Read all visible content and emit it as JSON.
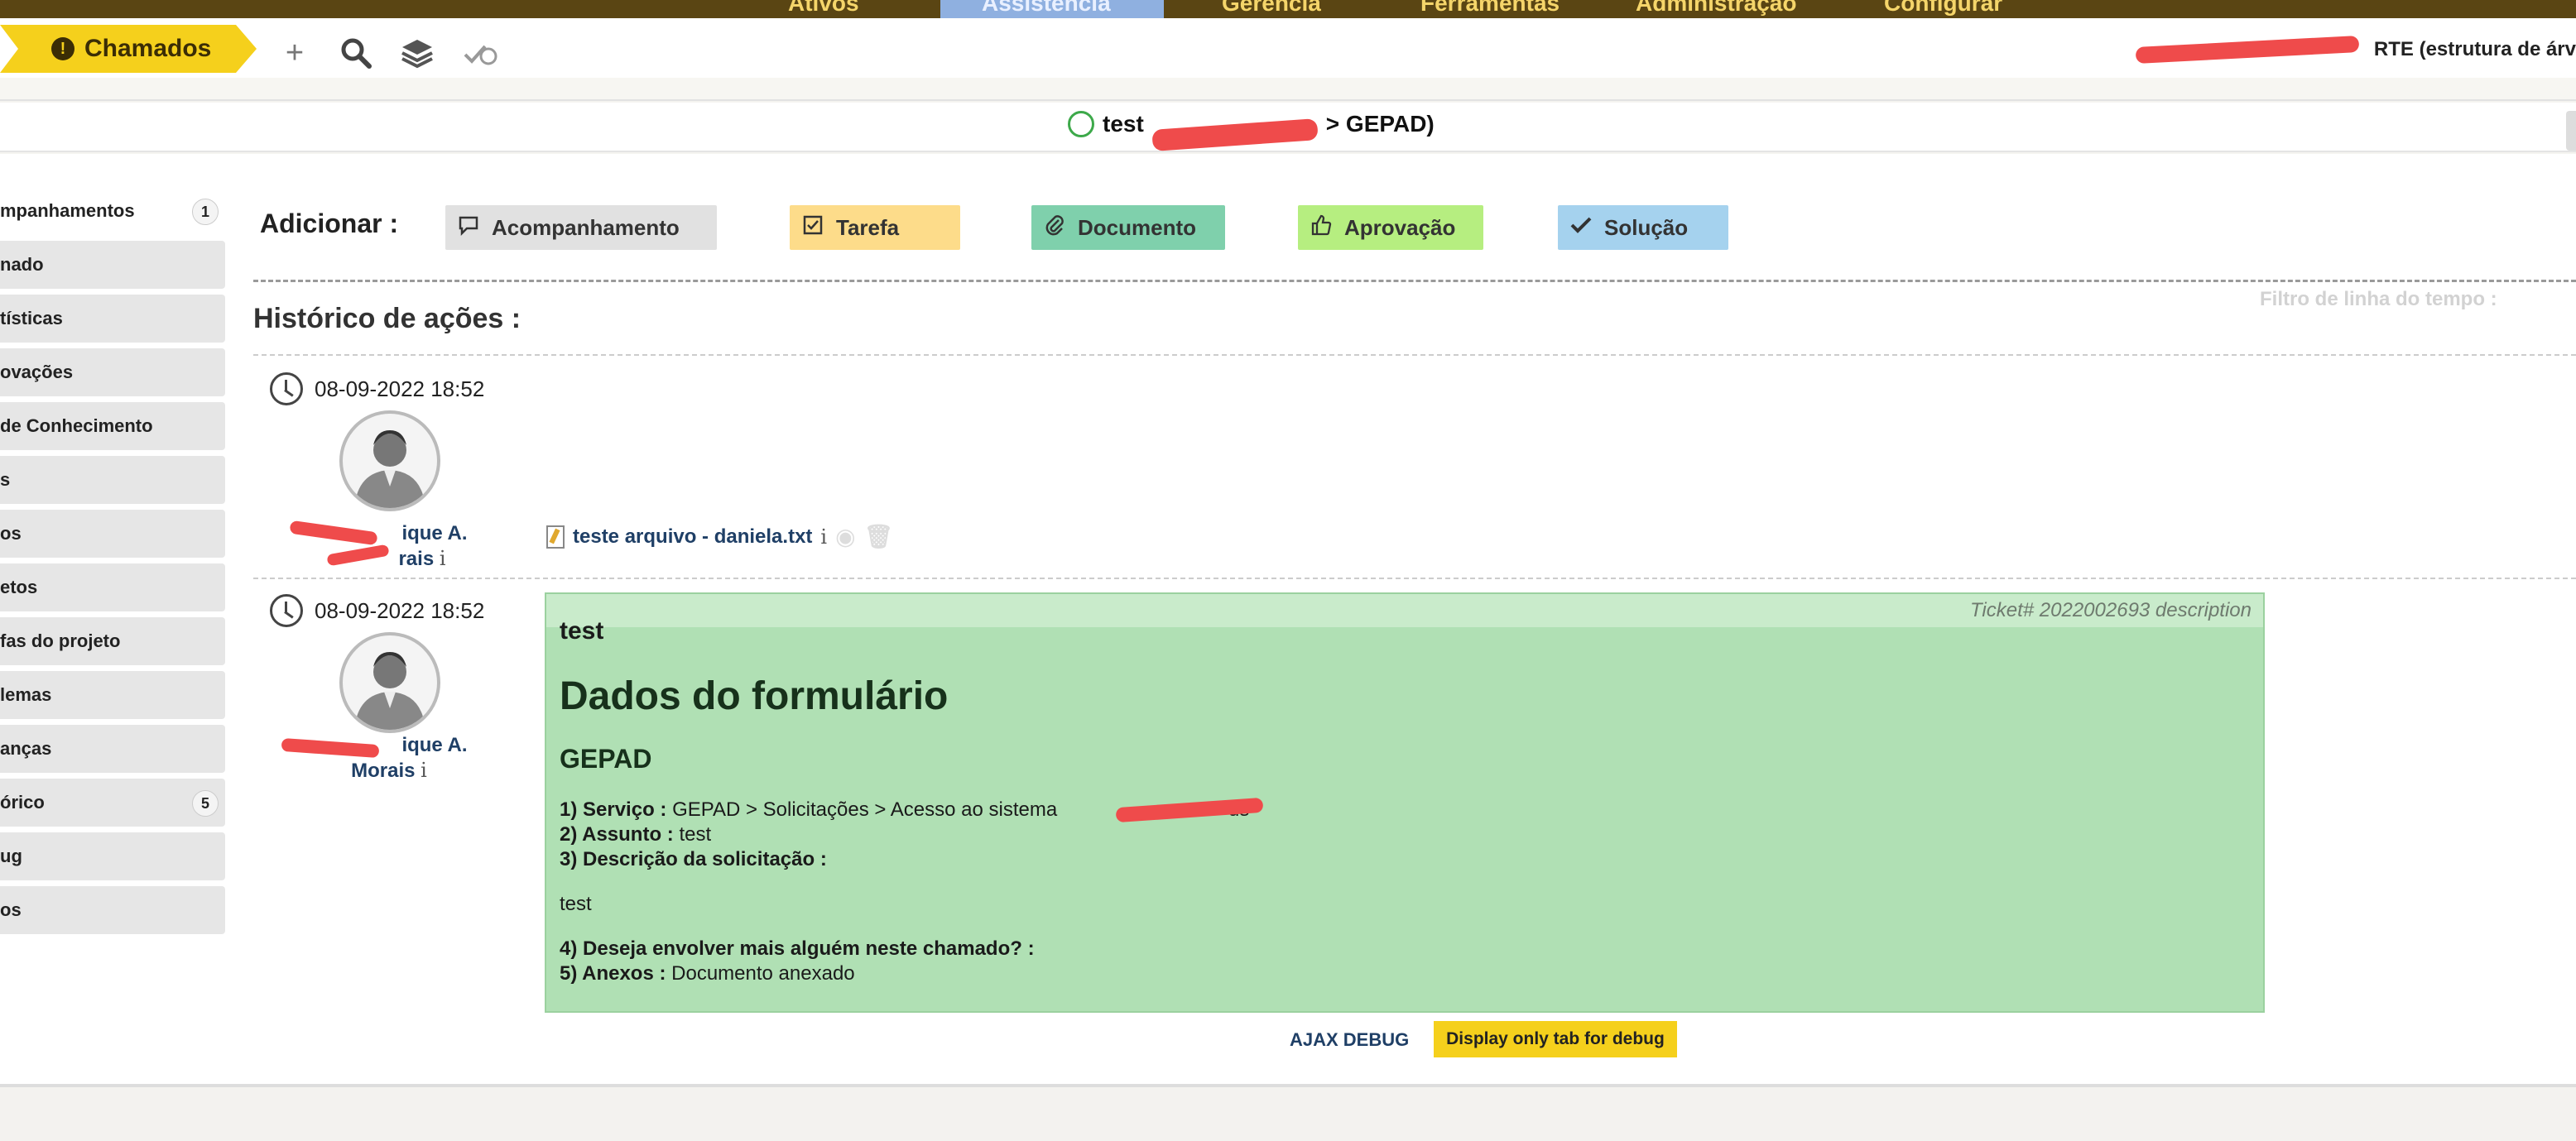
{
  "topbar": {
    "menu": [
      "Ativos",
      "Assistência",
      "Gerência",
      "Ferramentas",
      "Administração",
      "Configurar"
    ],
    "active_index": 1
  },
  "toolbar": {
    "tab_label": "Chamados",
    "icons": [
      "plus-icon",
      "search-icon",
      "layers-icon",
      "check-history-icon"
    ],
    "user_info": "RTE (estrutura de árv"
  },
  "ticket": {
    "title_prefix": "test",
    "title_path": "> GEPAD)"
  },
  "sidebar": {
    "items": [
      {
        "label": "mpanhamentos",
        "count": "1"
      },
      {
        "label": "nado",
        "count": ""
      },
      {
        "label": "tísticas",
        "count": ""
      },
      {
        "label": "ovações",
        "count": ""
      },
      {
        "label": "de Conhecimento",
        "count": ""
      },
      {
        "label": "s",
        "count": ""
      },
      {
        "label": "os",
        "count": ""
      },
      {
        "label": "etos",
        "count": ""
      },
      {
        "label": "fas do projeto",
        "count": ""
      },
      {
        "label": "lemas",
        "count": ""
      },
      {
        "label": "anças",
        "count": ""
      },
      {
        "label": "órico",
        "count": "5"
      },
      {
        "label": "ug",
        "count": ""
      },
      {
        "label": "os",
        "count": ""
      }
    ]
  },
  "add": {
    "label": "Adicionar :",
    "buttons": [
      {
        "label": "Acompanhamento",
        "icon": "speech-bubble-icon",
        "color": "#e1e1e1"
      },
      {
        "label": "Tarefa",
        "icon": "checkbox-icon",
        "color": "#fddc8a"
      },
      {
        "label": "Documento",
        "icon": "paperclip-icon",
        "color": "#7fd0ac"
      },
      {
        "label": "Aprovação",
        "icon": "thumbs-up-icon",
        "color": "#b6ee80"
      },
      {
        "label": "Solução",
        "icon": "checkmark-icon",
        "color": "#a5d2ee"
      }
    ]
  },
  "history": {
    "title": "Histórico de ações :",
    "filter": "Filtro de linha do tempo :",
    "entries": [
      {
        "date": "08-09-2022 18:52",
        "author_line1": "ique A.",
        "author_line2": "rais",
        "document": "teste arquivo - daniela.txt"
      },
      {
        "date": "08-09-2022 18:52",
        "author_line1": "ique A.",
        "author_line2": "Morais"
      }
    ]
  },
  "description": {
    "meta": "Ticket# 2022002693 description",
    "title": "test",
    "form_title": "Dados do formulário",
    "section": "GEPAD",
    "q1_label": "1) Serviço :",
    "q1_value": "GEPAD > Solicitações > Acesso ao sistema",
    "q1_tail": "us",
    "q2_label": "2) Assunto :",
    "q2_value": "test",
    "q3_label": "3) Descrição da solicitação :",
    "q3_value": "test",
    "q4_label": "4) Deseja envolver mais alguém neste chamado? :",
    "q5_label": "5) Anexos :",
    "q5_value": "Documento anexado"
  },
  "debug": {
    "ajax_label": "AJAX DEBUG",
    "tab_button": "Display only tab for debug"
  }
}
